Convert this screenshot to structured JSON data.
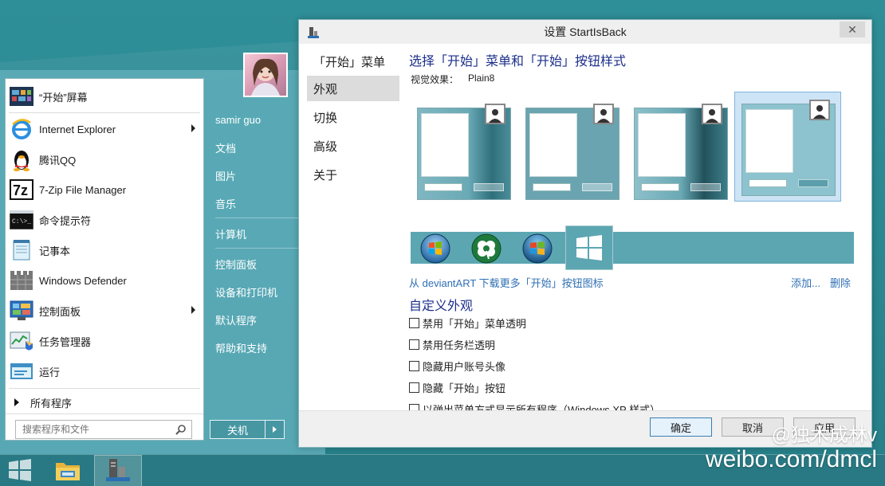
{
  "start_menu": {
    "items": [
      {
        "label": "“开始”屏幕",
        "icon": "start-screen-icon",
        "submenu": false
      },
      {
        "label": "Internet Explorer",
        "icon": "internet-explorer-icon",
        "submenu": true
      },
      {
        "label": "腾讯QQ",
        "icon": "qq-penguin-icon",
        "submenu": false
      },
      {
        "label": "7-Zip File Manager",
        "icon": "7zip-icon",
        "submenu": false
      },
      {
        "label": "命令提示符",
        "icon": "command-prompt-icon",
        "submenu": false
      },
      {
        "label": "记事本",
        "icon": "notepad-icon",
        "submenu": false
      },
      {
        "label": "Windows Defender",
        "icon": "windows-defender-icon",
        "submenu": false
      },
      {
        "label": "控制面板",
        "icon": "control-panel-icon",
        "submenu": true
      },
      {
        "label": "任务管理器",
        "icon": "task-manager-icon",
        "submenu": false
      },
      {
        "label": "运行",
        "icon": "run-icon",
        "submenu": false
      }
    ],
    "all_programs": "所有程序",
    "search_placeholder": "搜索程序和文件",
    "right_items": [
      "samir guo",
      "文档",
      "图片",
      "音乐",
      "计算机",
      "控制面板",
      "设备和打印机",
      "默认程序",
      "帮助和支持"
    ],
    "shutdown_label": "关机"
  },
  "settings": {
    "title": "设置 StartIsBack",
    "close_glyph": "✕",
    "nav": [
      "「开始」菜单",
      "外观",
      "切换",
      "高级",
      "关于"
    ],
    "active_nav": 1,
    "heading": "选择「开始」菜单和「开始」按钮样式",
    "visual_label": "视觉效果：",
    "visual_value": "Plain8",
    "selected_style": 3,
    "orb_icons": [
      "windows7-orb-icon",
      "clover-orb-icon",
      "windows-color-orb-icon",
      "windows8-logo-icon"
    ],
    "deviant_link": "从 deviantART 下载更多「开始」按钮图标",
    "add_link": "添加...",
    "delete_link": "删除",
    "custom_heading": "自定义外观",
    "checkboxes": [
      {
        "label": "禁用「开始」菜单透明",
        "checked": false
      },
      {
        "label": "禁用任务栏透明",
        "checked": false
      },
      {
        "label": "隐藏用户账号头像",
        "checked": false
      },
      {
        "label": "隐藏「开始」按钮",
        "checked": false
      },
      {
        "label": "以弹出菜单方式显示所有程序（Windows XP 样式）",
        "checked": false
      }
    ],
    "buttons": {
      "ok": "确定",
      "cancel": "取消",
      "apply": "应用"
    }
  },
  "watermark": {
    "line1": "@独木成林v",
    "line2": "weibo.com/dmcl"
  },
  "colors": {
    "accent": "#2f8f98",
    "link": "#2f6fb4",
    "heading": "#1c2f8a",
    "start_glass": "#5eadb9"
  }
}
